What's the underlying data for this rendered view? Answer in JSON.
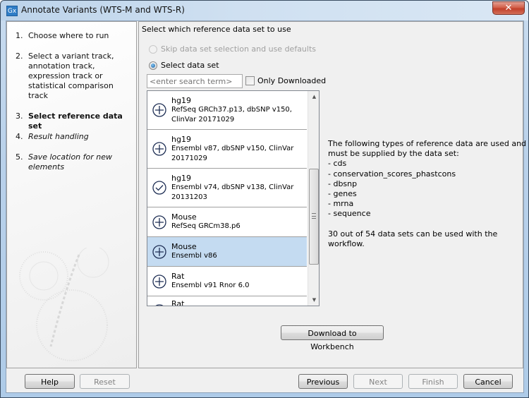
{
  "window": {
    "app_icon": "Gx",
    "title": "Annotate Variants (WTS-M and WTS-R)",
    "close_glyph": "✕"
  },
  "steps": [
    {
      "number": "1.",
      "label": "Choose where to run",
      "state": "done"
    },
    {
      "number": "2.",
      "label": "Select a variant track, annotation track, expression track or statistical comparison track",
      "state": "done"
    },
    {
      "number": "3.",
      "label": "Select reference data set",
      "state": "current"
    },
    {
      "number": "4.",
      "label": "Result handling",
      "state": "future"
    },
    {
      "number": "5.",
      "label": "Save location for new elements",
      "state": "future"
    }
  ],
  "main": {
    "section_title": "Select which reference data set to use",
    "options": [
      {
        "label": "Skip data set selection and use defaults",
        "checked": false,
        "enabled": false
      },
      {
        "label": "Select data set",
        "checked": true,
        "enabled": true
      }
    ],
    "search": {
      "value": "",
      "placeholder": "<enter search term>"
    },
    "only_downloaded": {
      "label": "Only Downloaded",
      "checked": false
    },
    "datasets": [
      {
        "name": "hg19",
        "description": "RefSeq GRCh37.p13, dbSNP v150, ClinVar 20171029",
        "status": "download",
        "icon": "plus-circle-icon",
        "selected": false
      },
      {
        "name": "hg19",
        "description": "Ensembl v87, dbSNP v150, ClinVar 20171029",
        "status": "download",
        "icon": "plus-circle-icon",
        "selected": false
      },
      {
        "name": "hg19",
        "description": "Ensembl v74, dbSNP v138, ClinVar 20131203",
        "status": "downloaded",
        "icon": "check-circle-icon",
        "selected": false
      },
      {
        "name": "Mouse",
        "description": "RefSeq GRCm38.p6",
        "status": "download",
        "icon": "plus-circle-icon",
        "selected": false
      },
      {
        "name": "Mouse",
        "description": "Ensembl v86",
        "status": "download",
        "icon": "plus-circle-icon",
        "selected": true
      },
      {
        "name": "Rat",
        "description": "Ensembl v91 Rnor 6.0",
        "status": "download",
        "icon": "plus-circle-icon",
        "selected": false
      },
      {
        "name": "Rat",
        "description": "",
        "status": "download",
        "icon": "plus-circle-icon",
        "selected": false
      }
    ],
    "info": {
      "intro": "The following types of reference data are used and\nmust be supplied by the data set:",
      "types": [
        "- cds",
        "- conservation_scores_phastcons",
        "- dbsnp",
        "- genes",
        "- mrna",
        "- sequence"
      ],
      "summary": "30 out of 54 data sets can be used with the\nworkflow."
    },
    "download_button": "Download to Workbench"
  },
  "footer": {
    "help": "Help",
    "reset": "Reset",
    "previous": "Previous",
    "next": "Next",
    "finish": "Finish",
    "cancel": "Cancel"
  }
}
